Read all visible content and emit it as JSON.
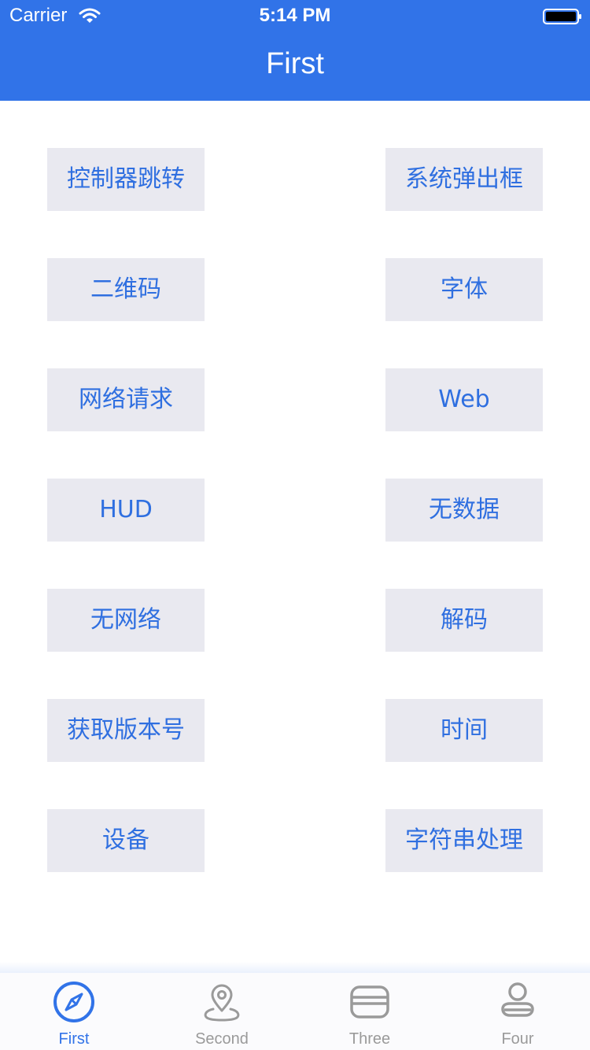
{
  "status_bar": {
    "carrier": "Carrier",
    "time": "5:14 PM"
  },
  "nav": {
    "title": "First"
  },
  "buttons": {
    "left": [
      "控制器跳转",
      "二维码",
      "网络请求",
      "HUD",
      "无网络",
      "获取版本号",
      "设备"
    ],
    "right": [
      "系统弹出框",
      "字体",
      "Web",
      "无数据",
      "解码",
      "时间",
      "字符串处理"
    ]
  },
  "tabs": [
    {
      "label": "First",
      "icon": "compass-icon",
      "active": true
    },
    {
      "label": "Second",
      "icon": "location-pin-icon",
      "active": false
    },
    {
      "label": "Three",
      "icon": "card-icon",
      "active": false
    },
    {
      "label": "Four",
      "icon": "person-icon",
      "active": false
    }
  ],
  "colors": {
    "accent": "#3173e8",
    "button_bg": "#e9e9f0",
    "button_text": "#2f6fe0",
    "tab_inactive": "#9a9a9a"
  }
}
